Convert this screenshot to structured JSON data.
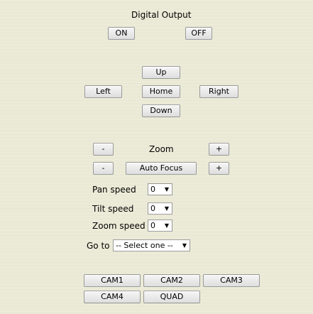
{
  "digital_output": {
    "title": "Digital Output",
    "on_label": "ON",
    "off_label": "OFF"
  },
  "ptz": {
    "up_label": "Up",
    "left_label": "Left",
    "home_label": "Home",
    "right_label": "Right",
    "down_label": "Down"
  },
  "zoom": {
    "label": "Zoom",
    "minus_label": "-",
    "plus_label": "+"
  },
  "focus": {
    "label": "Auto Focus",
    "minus_label": "-",
    "plus_label": "+"
  },
  "speeds": {
    "pan_label": "Pan speed",
    "pan_value": "0",
    "tilt_label": "Tilt speed",
    "tilt_value": "0",
    "zoom_label": "Zoom speed",
    "zoom_value": "0"
  },
  "goto": {
    "label": "Go to",
    "value": "-- Select one --"
  },
  "cameras": {
    "cam1": "CAM1",
    "cam2": "CAM2",
    "cam3": "CAM3",
    "cam4": "CAM4",
    "quad": "QUAD"
  },
  "icons": {
    "dropdown_arrow": "▼"
  }
}
